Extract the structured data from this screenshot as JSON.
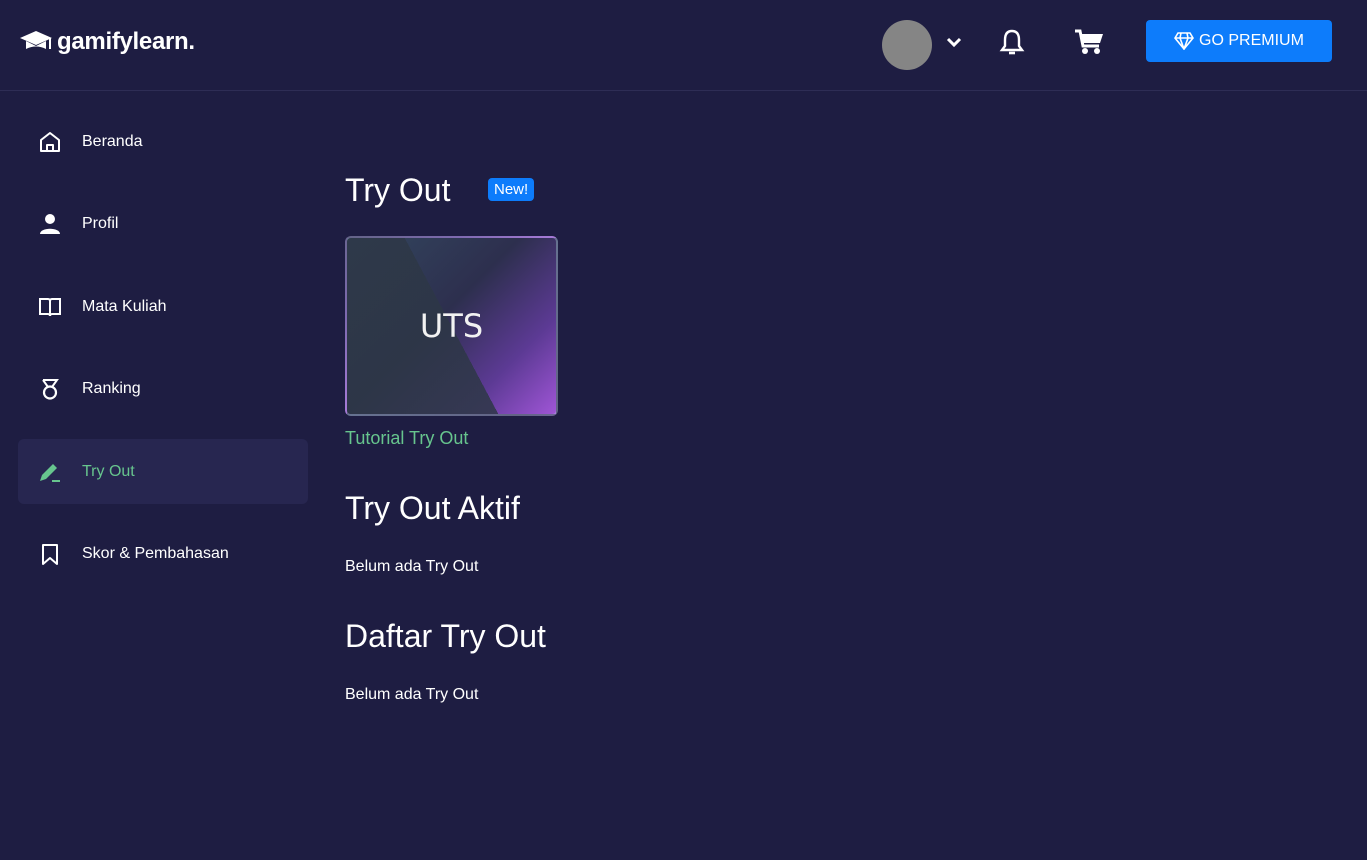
{
  "header": {
    "logo_text": "gamifylearn.",
    "premium_label": "GO PREMIUM"
  },
  "sidebar": {
    "items": [
      {
        "label": "Beranda",
        "icon": "home-icon"
      },
      {
        "label": "Profil",
        "icon": "user-icon"
      },
      {
        "label": "Mata Kuliah",
        "icon": "book-icon"
      },
      {
        "label": "Ranking",
        "icon": "medal-icon"
      },
      {
        "label": "Try Out",
        "icon": "pencil-icon",
        "active": true
      },
      {
        "label": "Skor & Pembahasan",
        "icon": "bookmark-icon"
      }
    ]
  },
  "main": {
    "tryout_title": "Try Out",
    "new_badge": "New!",
    "card_label": "UTS",
    "card_caption": "Tutorial Try Out",
    "active_title": "Try Out Aktif",
    "active_empty": "Belum ada Try Out",
    "list_title": "Daftar Try Out",
    "list_empty": "Belum ada Try Out"
  },
  "colors": {
    "background": "#1e1d42",
    "accent": "#0d7cfb",
    "active_text": "#67c58e"
  }
}
